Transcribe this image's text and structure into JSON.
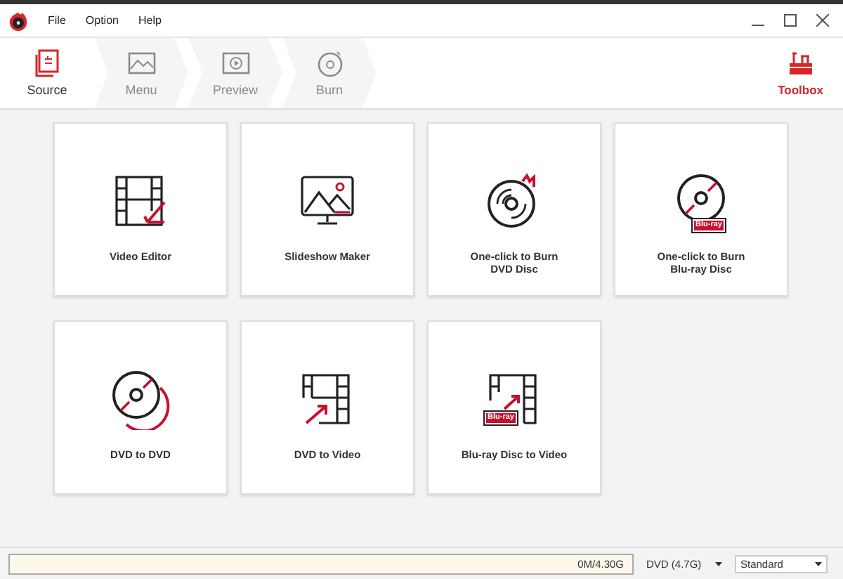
{
  "menu": [
    "File",
    "Option",
    "Help"
  ],
  "steps": [
    {
      "kind": "source",
      "label": "Source",
      "selected": true,
      "disabled": false
    },
    {
      "kind": "menu",
      "label": "Menu",
      "selected": false,
      "disabled": true
    },
    {
      "kind": "preview",
      "label": "Preview",
      "selected": false,
      "disabled": true
    },
    {
      "kind": "burn",
      "label": "Burn",
      "selected": false,
      "disabled": true
    }
  ],
  "toolbox": {
    "label": "Toolbox"
  },
  "tiles": [
    {
      "kind": "video-editor",
      "lines": [
        "Video Editor"
      ]
    },
    {
      "kind": "slideshow",
      "lines": [
        "Slideshow Maker"
      ]
    },
    {
      "kind": "burn-dvd",
      "lines": [
        "One-click to Burn",
        "DVD Disc"
      ]
    },
    {
      "kind": "burn-bluray",
      "lines": [
        "One-click to Burn",
        "Blu-ray Disc"
      ],
      "badge": "Blu-ray"
    },
    {
      "kind": "dvd-to-dvd",
      "lines": [
        "DVD to DVD"
      ]
    },
    {
      "kind": "dvd-to-video",
      "lines": [
        "DVD to Video"
      ]
    },
    {
      "kind": "bluray-to-video",
      "lines": [
        "Blu-ray Disc to Video"
      ],
      "badge": "Blu-ray"
    }
  ],
  "status_bar": {
    "capacity": {
      "reading": "0M/4.30G"
    },
    "disc_type": "DVD (4.7G)",
    "quality": "Standard"
  }
}
